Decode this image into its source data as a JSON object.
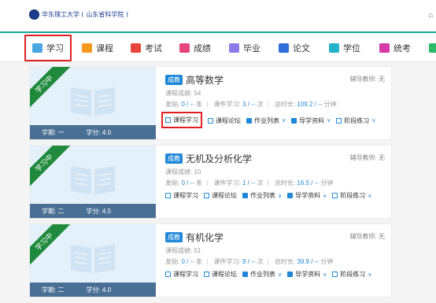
{
  "header": {
    "logo_text": "华东理工大学 ( 山东省科学院 )",
    "home_icon": "home-icon"
  },
  "nav": {
    "items": [
      {
        "label": "学习",
        "icon": "study-icon",
        "color": "#4aa7e3"
      },
      {
        "label": "课程",
        "icon": "course-icon",
        "color": "#f39a1e"
      },
      {
        "label": "考试",
        "icon": "exam-icon",
        "color": "#e9443c"
      },
      {
        "label": "成绩",
        "icon": "grade-icon",
        "color": "#e8457e"
      },
      {
        "label": "毕业",
        "icon": "graduation-icon",
        "color": "#8f7be6"
      },
      {
        "label": "论文",
        "icon": "thesis-icon",
        "color": "#2b6fd6"
      },
      {
        "label": "学位",
        "icon": "degree-icon",
        "color": "#23b3c7"
      },
      {
        "label": "统考",
        "icon": "unified-exam-icon",
        "color": "#d63aa8"
      }
    ]
  },
  "courses": [
    {
      "ribbon": "学习中",
      "term": "学期: 一",
      "credit": "学分: 4.0",
      "badge": "成教",
      "title": "高等数学",
      "teacher": "辅导教师: 无",
      "score": "课程成绩: 54",
      "posts_label": "发贴:",
      "posts": "0 / --",
      "posts_unit": "条",
      "study_label": "课件学习:",
      "study": "3 / --",
      "study_unit": "次",
      "time_label": "总时长:",
      "time": "109.2 / --",
      "time_unit": "分钟"
    },
    {
      "ribbon": "学习中",
      "term": "学期: 二",
      "credit": "学分: 4.5",
      "badge": "成教",
      "title": "无机及分析化学",
      "teacher": "辅导教师: 无",
      "score": "课程成绩: 10",
      "posts_label": "发贴:",
      "posts": "0 / --",
      "posts_unit": "条",
      "study_label": "课件学习:",
      "study": "1 / --",
      "study_unit": "次",
      "time_label": "总时长:",
      "time": "16.5 / --",
      "time_unit": "分钟"
    },
    {
      "ribbon": "学习中",
      "term": "学期: 二",
      "credit": "学分: 4.0",
      "badge": "成教",
      "title": "有机化学",
      "teacher": "辅导教师: 无",
      "score": "课程成绩: 51",
      "posts_label": "发贴:",
      "posts": "0 / --",
      "posts_unit": "条",
      "study_label": "课件学习:",
      "study": "9 / --",
      "study_unit": "次",
      "time_label": "总时长:",
      "time": "39.9 / --",
      "time_unit": "分钟"
    }
  ],
  "actions": {
    "study": "课程学习",
    "forum": "课程论坛",
    "homework": "作业列表",
    "materials": "导学资料",
    "practice": "阶段练习"
  }
}
